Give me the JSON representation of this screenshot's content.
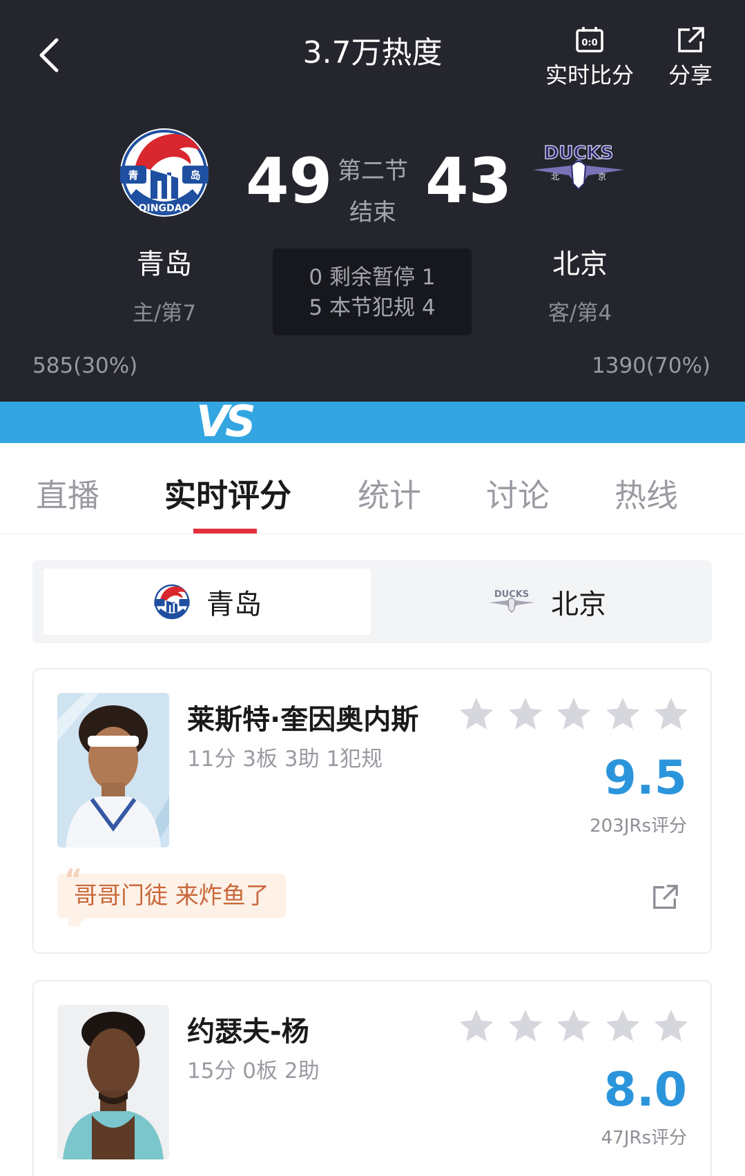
{
  "header": {
    "title": "3.7万热度",
    "actions": {
      "live_score": "实时比分",
      "share": "分享"
    },
    "home": {
      "name": "青岛",
      "rank": "主/第7",
      "score": "49",
      "support": "585(30%)",
      "logo_text": "QINGDAO",
      "logo_chars": "青 岛"
    },
    "away": {
      "name": "北京",
      "rank": "客/第4",
      "score": "43",
      "support": "1390(70%)",
      "logo_text": "DUCKS",
      "logo_chars": "北 京"
    },
    "period": {
      "line1": "第二节",
      "line2": "结束"
    },
    "middle": {
      "timeouts": "0 剩余暂停 1",
      "fouls": "5 本节犯规 4"
    },
    "live_icon_text": "0:0"
  },
  "vs": "VS",
  "tabs": [
    "直播",
    "实时评分",
    "统计",
    "讨论",
    "热线"
  ],
  "active_tab": 1,
  "team_switch": {
    "home": "青岛",
    "away": "北京",
    "selected": "home"
  },
  "players": [
    {
      "name": "莱斯特·奎因奥内斯",
      "stats": "11分 3板 3助 1犯规",
      "stars": 0,
      "rating": "9.5",
      "rating_count": "203JRs评分",
      "comment": "哥哥门徒 来炸鱼了"
    },
    {
      "name": "约瑟夫-杨",
      "stats": "15分 0板 2助",
      "stars": 0,
      "rating": "8.0",
      "rating_count": "47JRs评分"
    }
  ],
  "colors": {
    "header_bg": "#25262d",
    "vs_bar": "#33a6e2",
    "tab_accent": "#e4303c",
    "rating": "#2b95dc",
    "comment_bg": "#fdf1e8",
    "comment_text": "#c8683a",
    "star_empty": "#d5d7dc"
  },
  "icons": [
    "chevron-left-icon",
    "scoreboard-icon",
    "share-icon",
    "star-icon",
    "external-link-icon"
  ]
}
